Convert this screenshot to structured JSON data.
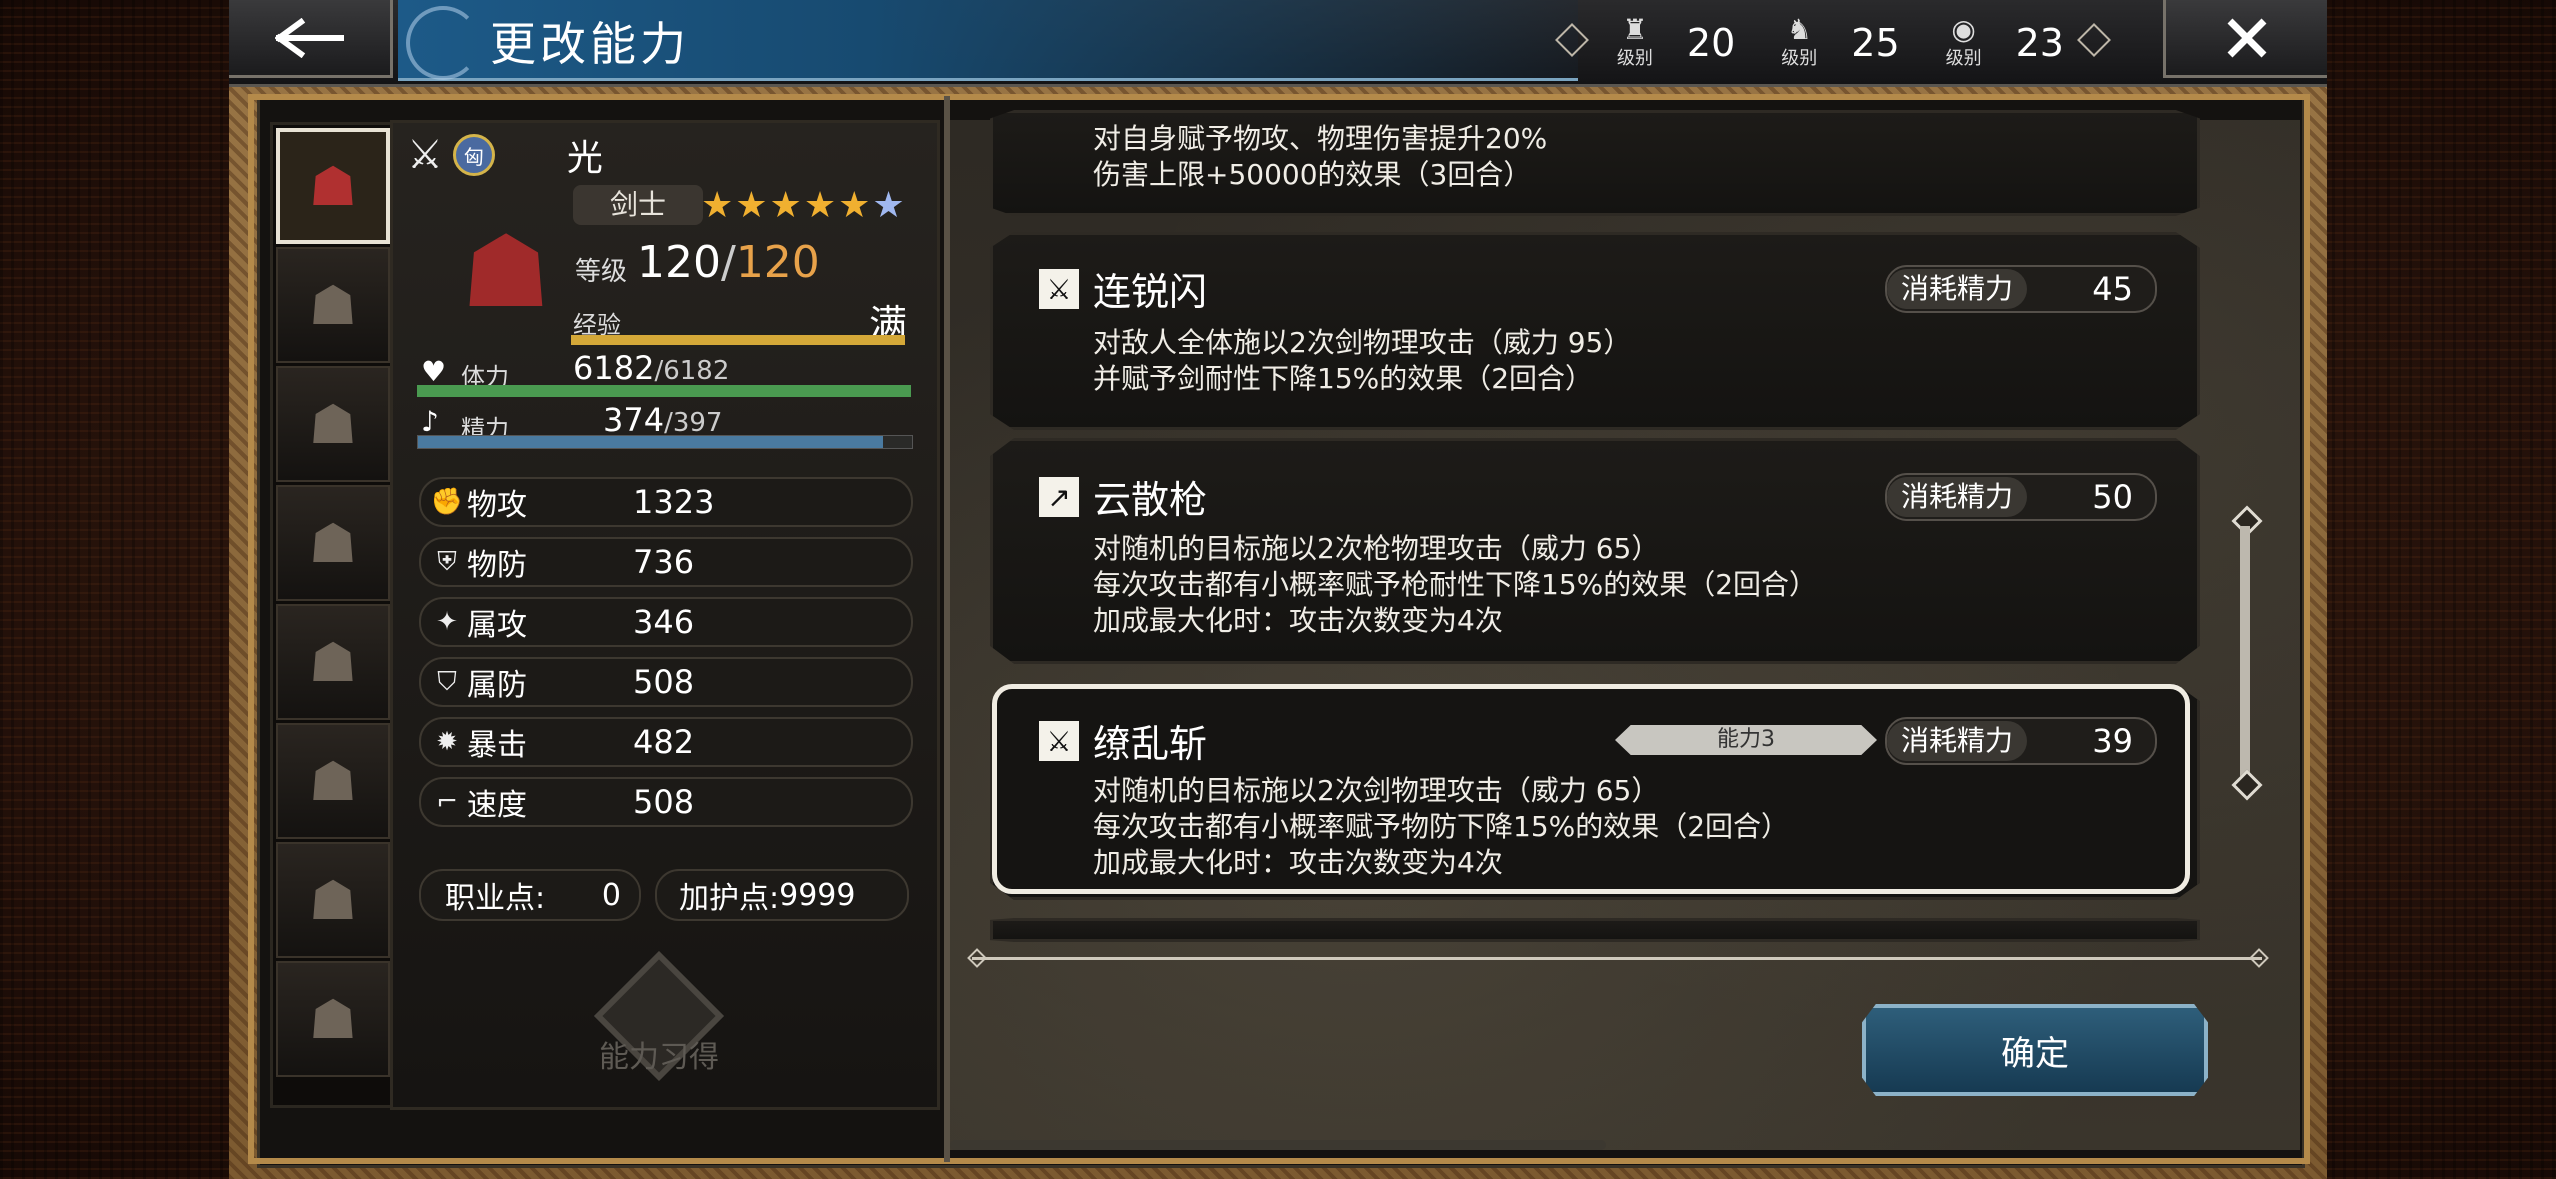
{
  "header": {
    "title": "更改能力",
    "levels": [
      {
        "icon": "crown-level-icon",
        "label": "级别",
        "value": "20"
      },
      {
        "icon": "beast-level-icon",
        "label": "级别",
        "value": "25"
      },
      {
        "icon": "eye-level-icon",
        "label": "级别",
        "value": "23"
      }
    ]
  },
  "character": {
    "name": "光",
    "weapon_badge": "匈",
    "job": "剑士",
    "stars": "★★★★★",
    "star_extra": "★",
    "level_label": "等级",
    "level_current": "120",
    "level_sep": "/",
    "level_max": "120",
    "exp_label": "经验",
    "exp_status": "满",
    "hp_label": "体力",
    "hp_current": "6182",
    "hp_max": "/6182",
    "hp_fraction": 1.0,
    "mp_label": "精力",
    "mp_current": "374",
    "mp_max": "/397",
    "mp_fraction": 0.942
  },
  "stats": [
    {
      "name": "物攻",
      "value": "1323",
      "icon": "fist-icon"
    },
    {
      "name": "物防",
      "value": "736",
      "icon": "shield-icon"
    },
    {
      "name": "属攻",
      "value": "346",
      "icon": "sparkle-icon"
    },
    {
      "name": "属防",
      "value": "508",
      "icon": "magic-shield-icon"
    },
    {
      "name": "暴击",
      "value": "482",
      "icon": "burst-icon"
    },
    {
      "name": "速度",
      "value": "508",
      "icon": "boot-icon"
    }
  ],
  "points": {
    "job_label": "职业点:",
    "job_value": "0",
    "guard_label": "加护点:",
    "guard_value": "9999"
  },
  "learn_button": "能力习得",
  "skills": [
    {
      "name": "",
      "desc": "对自身赋予物攻、物理伤害提升20%\n伤害上限+50000的效果（3回合）"
    },
    {
      "name": "连锐闪",
      "cost_label": "消耗精力",
      "cost": "45",
      "desc": "对敌人全体施以2次剑物理攻击（威力 95）\n并赋予剑耐性下降15%的效果（2回合）"
    },
    {
      "name": "云散枪",
      "cost_label": "消耗精力",
      "cost": "50",
      "desc": "对随机的目标施以2次枪物理攻击（威力 65）\n每次攻击都有小概率赋予枪耐性下降15%的效果（2回合）\n加成最大化时：攻击次数变为4次"
    },
    {
      "name": "缭乱斩",
      "tag": "能力3",
      "cost_label": "消耗精力",
      "cost": "39",
      "desc": "对随机的目标施以2次剑物理攻击（威力 65）\n每次攻击都有小概率赋予物防下降15%的效果（2回合）\n加成最大化时：攻击次数变为4次"
    }
  ],
  "confirm_button": "确定"
}
